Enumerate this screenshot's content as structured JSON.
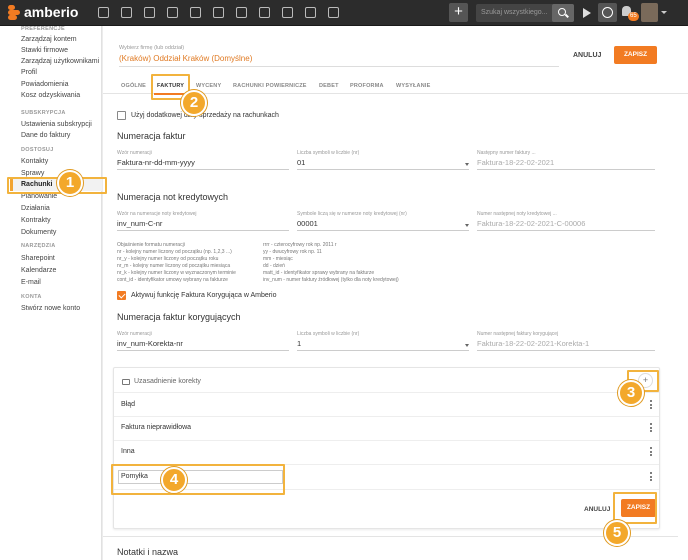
{
  "app": {
    "logo_text": "amberio"
  },
  "topbar": {
    "search_placeholder": "Szukaj wszystkiego...",
    "notification_count": "65"
  },
  "sidebar": {
    "groups": [
      {
        "header": "PREFERENCJE",
        "items": [
          "Zarządzaj kontem",
          "Stawki firmowe",
          "Zarządzaj użytkownikami",
          "Profil",
          "Powiadomienia",
          "Kosz odzyskiwania"
        ]
      },
      {
        "header": "SUBSKRYPCJA",
        "items": [
          "Ustawienia subskrypcji",
          "Dane do faktury"
        ]
      },
      {
        "header": "DOSTOSUJ",
        "items": [
          "Kontakty",
          "Sprawy",
          "Rachunki",
          "Planowanie",
          "Działania",
          "Kontrakty",
          "Dokumenty"
        ]
      },
      {
        "header": "NARZĘDZIA",
        "items": [
          "Sharepoint",
          "Kalendarze",
          "E-mail"
        ]
      },
      {
        "header": "KONTA",
        "items": [
          "Stwórz nowe konto"
        ]
      }
    ],
    "active_item": "Rachunki"
  },
  "firm": {
    "label": "Wybierz firmę (lub oddział)",
    "value": "(Kraków) Oddział Kraków (Domyślne)"
  },
  "actions": {
    "cancel": "ANULUJ",
    "save": "ZAPISZ"
  },
  "tabs": [
    "OGÓLNE",
    "FAKTURY",
    "WYCENY",
    "RACHUNKI POWIERNICZE",
    "DEBET",
    "PROFORMA",
    "WYSYŁANIE"
  ],
  "active_tab": "FAKTURY",
  "option_dates": {
    "label": "Użyj dodatkowej daty sprzedaży na rachunkach",
    "checked": false
  },
  "invoice_numbering": {
    "title": "Numeracja faktur",
    "pattern_label": "Wzór numeracji",
    "pattern_value": "Faktura-nr-dd-mm-yyyy",
    "digits_label": "Liczba symboli w liczbie (nr)",
    "digits_value": "01",
    "next_label": "Następny numer faktury ...",
    "next_value": "Faktura-18-22-02-2021"
  },
  "credit_numbering": {
    "title": "Numeracja not kredytowych",
    "pattern_label": "Wzór na numeracje noty kredytowej",
    "pattern_value": "inv_num-C-nr",
    "digits_label": "Symbole liczą się w numerze noty kredytowej (nr)",
    "digits_value": "00001",
    "next_label": "Numer następnej noty kredytowej ...",
    "next_value": "Faktura-18-22-02-2021-C-00006"
  },
  "help_text": {
    "left": [
      "Objaśnienie formatu numeracji",
      "nr - kolejny numer liczony od początku (np. 1,2,3 ...)",
      "nr_y - kolejny numer liczony od początku roku",
      "nr_m - kolejny numer liczony od początku miesiąca",
      "nr_k - kolejny numer liczony w wyznaczonym terminie",
      "cont_id - identyfikator umowy wybrany na fakturze"
    ],
    "right": [
      "rrrr - czterocyfrowy rok np. 2011 r",
      "yy - dwucyfrowy rok np. 11",
      "mm - miesiąc",
      "dd - dzień",
      "matt_id - identyfikator sprawy wybrany na fakturze",
      "inv_num - numer faktury źródłowej (tylko dla noty kredytowej)"
    ]
  },
  "option_correction": {
    "label": "Aktywuj funkcję Faktura Korygująca w Amberio",
    "checked": true
  },
  "correction_numbering": {
    "title": "Numeracja faktur korygujących",
    "pattern_label": "Wzór numeracji",
    "pattern_value": "inv_num-Korekta-nr",
    "digits_label": "Liczba symboli w liczbie (nr)",
    "digits_value": "1",
    "next_label": "Numer następnej faktury korygującej",
    "next_value": "Faktura-18-22-02-2021-Korekta-1"
  },
  "reasons_card": {
    "title": "Uzasadnienie korekty",
    "items": [
      "Błąd",
      "Faktura nieprawidłowa",
      "Inna"
    ],
    "new_value": "Pomyłka",
    "cancel": "ANULUJ",
    "save": "ZAPISZ"
  },
  "notes_section": {
    "title": "Notatki i nazwa"
  },
  "steps": [
    "1",
    "2",
    "3",
    "4",
    "5"
  ],
  "colors": {
    "accent": "#f27b22",
    "highlight": "#f2b33d"
  }
}
